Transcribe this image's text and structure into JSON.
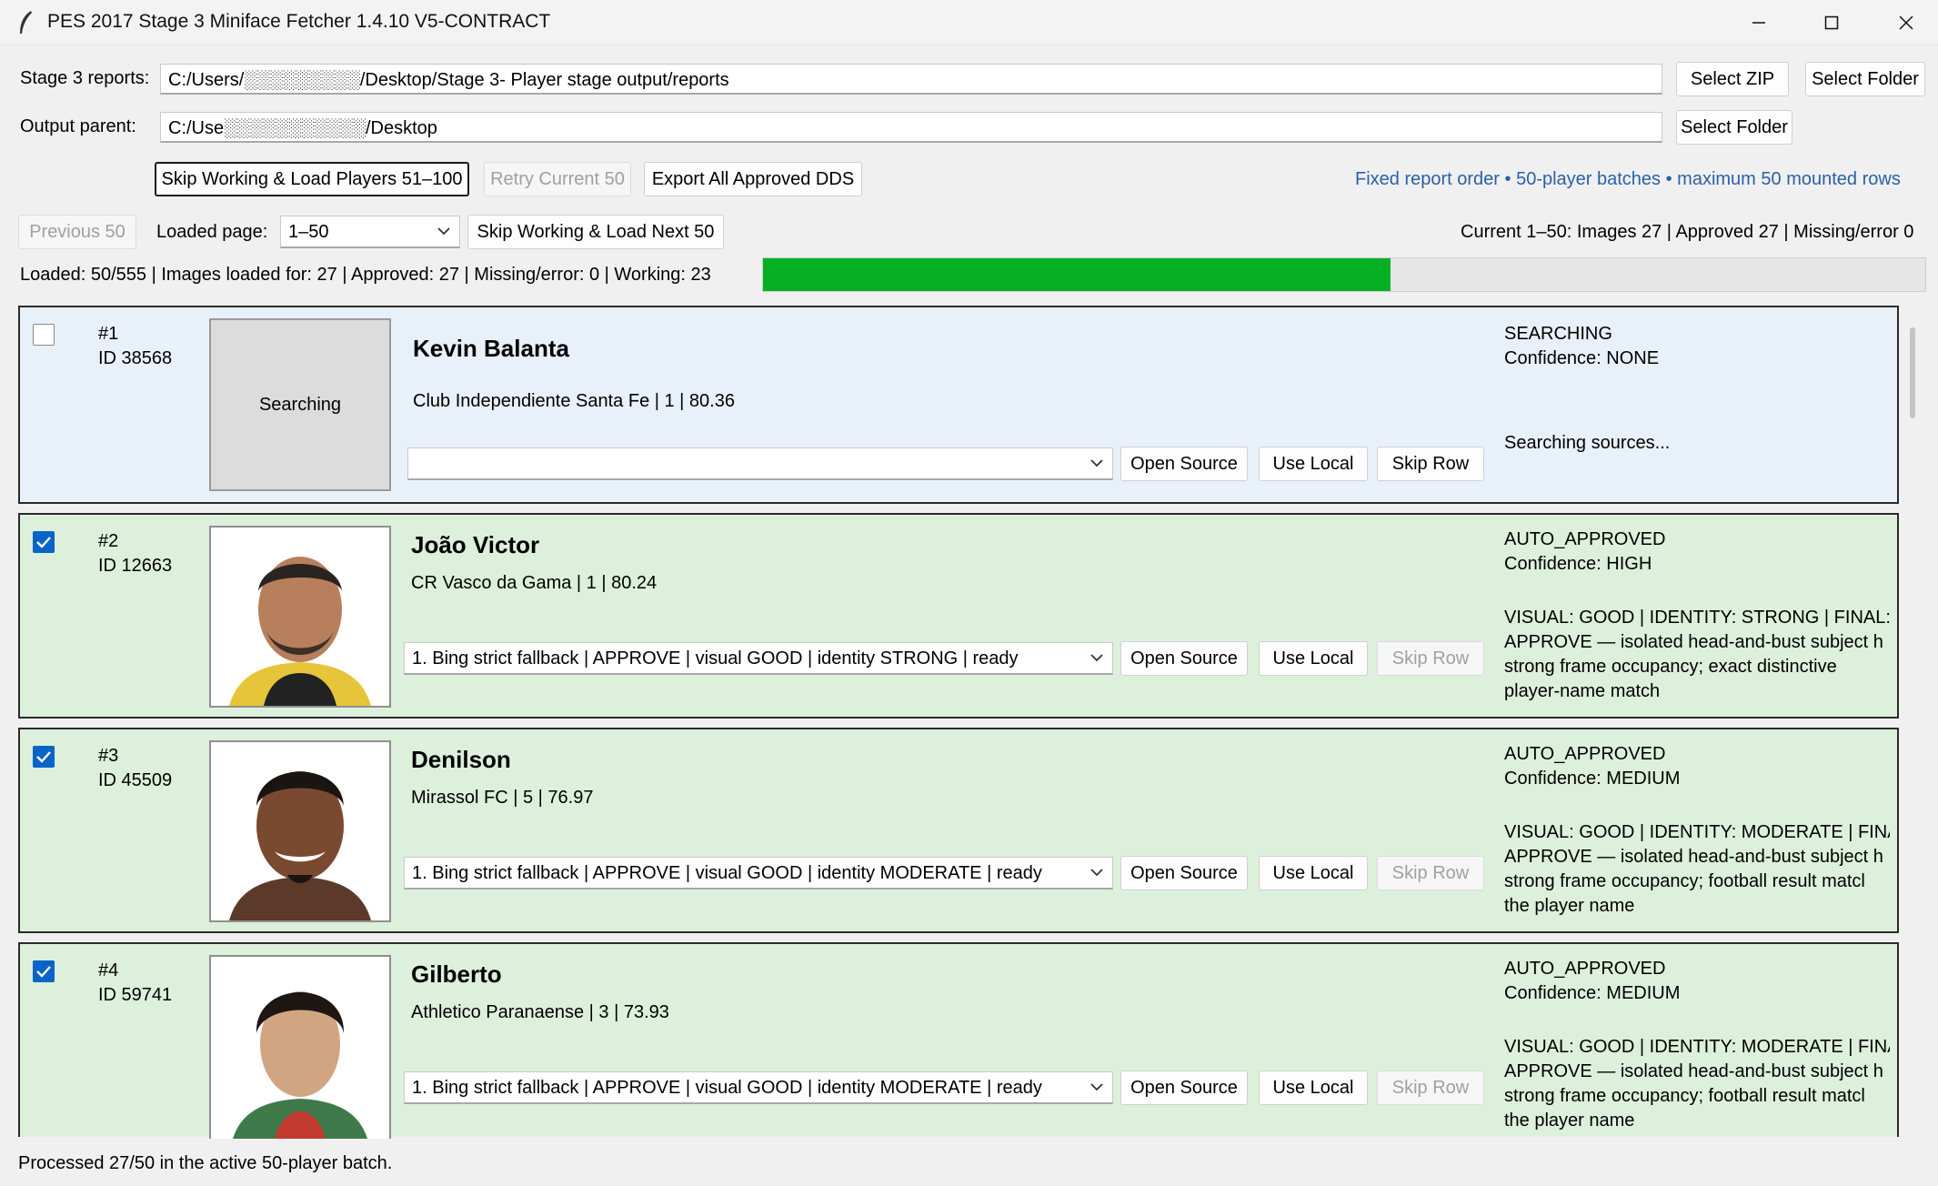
{
  "window": {
    "title": "PES 2017 Stage 3 Miniface Fetcher 1.4.10 V5-CONTRACT",
    "icon": "feather-icon"
  },
  "paths": {
    "reports_label": "Stage 3 reports:",
    "reports_value": "C:/Users/░░░░░░░░░/Desktop/Stage 3- Player stage output/reports",
    "output_label": "Output parent:",
    "output_value": "C:/Use░░░░░░░░░░░/Desktop",
    "select_zip": "Select ZIP",
    "select_folder": "Select Folder",
    "select_folder_2": "Select Folder"
  },
  "actions": {
    "skip_load_51": "Skip Working & Load Players 51–100",
    "retry_current": "Retry Current 50",
    "export_all": "Export All Approved DDS",
    "note": "Fixed report order • 50-player batches • maximum 50 mounted rows",
    "previous": "Previous 50",
    "loaded_page_label": "Loaded page:",
    "loaded_page_value": "1–50",
    "skip_load_next": "Skip Working & Load Next 50",
    "current_summary": "Current 1–50: Images 27 | Approved 27 | Missing/error 0"
  },
  "progress": {
    "text": "Loaded: 50/555 | Images loaded for: 27 | Approved: 27 | Missing/error: 0 | Working: 23",
    "fraction": 0.54
  },
  "rows": [
    {
      "num": "#1",
      "id": "ID 38568",
      "checked": false,
      "name": "Kevin Balanta",
      "info": "Club Independiente Santa Fe  |  1  |  80.36",
      "thumb_text": "Searching",
      "combo": "",
      "open_source": "Open Source",
      "use_local": "Use Local",
      "skip_row": "Skip Row",
      "status": "SEARCHING",
      "confidence": "Confidence: NONE",
      "detail": [
        "Searching sources..."
      ]
    },
    {
      "num": "#2",
      "id": "ID 12663",
      "checked": true,
      "name": "João Victor",
      "info": "CR Vasco da Gama  |  1  |  80.24",
      "combo": "1. Bing strict fallback | APPROVE | visual GOOD | identity STRONG | ready",
      "open_source": "Open Source",
      "use_local": "Use Local",
      "skip_row": "Skip Row",
      "status": "AUTO_APPROVED",
      "confidence": "Confidence: HIGH",
      "detail": [
        "VISUAL: GOOD | IDENTITY: STRONG | FINAL:",
        "APPROVE — isolated head-and-bust subject h",
        "strong frame occupancy; exact distinctive",
        "player-name match"
      ]
    },
    {
      "num": "#3",
      "id": "ID 45509",
      "checked": true,
      "name": "Denilson",
      "info": "Mirassol FC  |  5  |  76.97",
      "combo": "1. Bing strict fallback | APPROVE | visual GOOD | identity MODERATE | ready",
      "open_source": "Open Source",
      "use_local": "Use Local",
      "skip_row": "Skip Row",
      "status": "AUTO_APPROVED",
      "confidence": "Confidence: MEDIUM",
      "detail": [
        "VISUAL: GOOD | IDENTITY: MODERATE | FINA",
        "APPROVE — isolated head-and-bust subject h",
        "strong frame occupancy; football result matcl",
        "the player name"
      ]
    },
    {
      "num": "#4",
      "id": "ID 59741",
      "checked": true,
      "name": "Gilberto",
      "info": "Athletico Paranaense  |  3  |  73.93",
      "combo": "1. Bing strict fallback | APPROVE | visual GOOD | identity MODERATE | ready",
      "open_source": "Open Source",
      "use_local": "Use Local",
      "skip_row": "Skip Row",
      "status": "AUTO_APPROVED",
      "confidence": "Confidence: MEDIUM",
      "detail": [
        "VISUAL: GOOD | IDENTITY: MODERATE | FINA",
        "APPROVE — isolated head-and-bust subject h",
        "strong frame occupancy; football result matcl",
        "the player name"
      ]
    }
  ],
  "statusbar": "Processed 27/50 in the active 50-player batch.",
  "colors": {
    "progress_fill": "#06b025",
    "searching_row": "#e8f0fa",
    "approved_row": "#dcf0dc",
    "note_link": "#2b5fa8",
    "checkbox_on": "#0a64c8"
  }
}
